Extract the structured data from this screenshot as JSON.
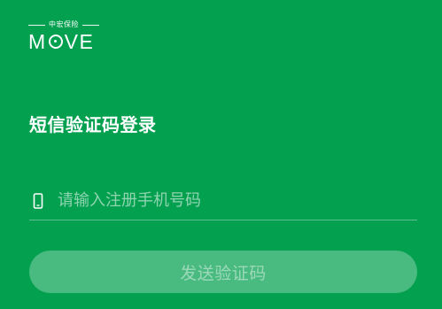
{
  "brand": {
    "subtitle": "中宏保险",
    "name_m": "M",
    "name_rest": "VE"
  },
  "login": {
    "title": "短信验证码登录",
    "phone_placeholder": "请输入注册手机号码",
    "phone_value": "",
    "send_button_label": "发送验证码"
  },
  "icons": {
    "phone": "mobile-phone-icon"
  },
  "colors": {
    "background": "#03a04f",
    "text": "#ffffff"
  }
}
